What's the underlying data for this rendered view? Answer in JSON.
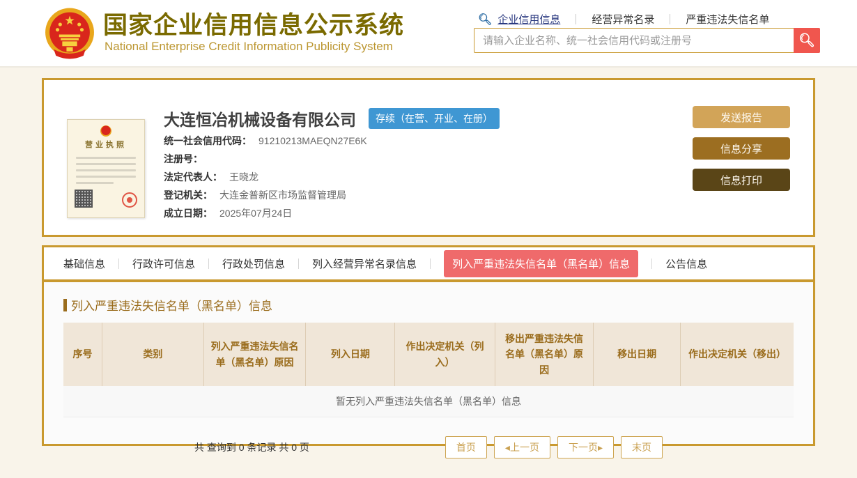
{
  "header": {
    "title": "国家企业信用信息公示系统",
    "subtitle": "National Enterprise Credit Information Publicity System",
    "search_icon": "search-icon",
    "nav": [
      {
        "label": "企业信用信息"
      },
      {
        "label": "经营异常名录"
      },
      {
        "label": "严重违法失信名单"
      }
    ],
    "search": {
      "placeholder": "请输入企业名称、统一社会信用代码或注册号",
      "value": "",
      "button_icon": "search-icon"
    }
  },
  "company": {
    "name": "大连恒冶机械设备有限公司",
    "status_badge": "存续（在营、开业、在册）",
    "license_title": "营业执照",
    "fields": [
      {
        "label": "统一社会信用代码：",
        "value": "91210213MAEQN27E6K"
      },
      {
        "label": "注册号：",
        "value": ""
      },
      {
        "label": "法定代表人：",
        "value": "王晓龙"
      },
      {
        "label": "登记机关：",
        "value": "大连金普新区市场监督管理局"
      },
      {
        "label": "成立日期：",
        "value": "2025年07月24日"
      }
    ],
    "actions": [
      {
        "label": "发送报告",
        "color": "#d2a458"
      },
      {
        "label": "信息分享",
        "color": "#9c6e21"
      },
      {
        "label": "信息打印",
        "color": "#5a4517"
      }
    ]
  },
  "tabs": [
    {
      "label": "基础信息",
      "active": false
    },
    {
      "label": "行政许可信息",
      "active": false
    },
    {
      "label": "行政处罚信息",
      "active": false
    },
    {
      "label": "列入经营异常名录信息",
      "active": false
    },
    {
      "label": "列入严重违法失信名单（黑名单）信息",
      "active": true
    },
    {
      "label": "公告信息",
      "active": false
    }
  ],
  "section": {
    "title": "列入严重违法失信名单（黑名单）信息"
  },
  "table": {
    "headers": [
      "序号",
      "类别",
      "列入严重违法失信名单（黑名单）原因",
      "列入日期",
      "作出决定机关（列入）",
      "移出严重违法失信名单（黑名单）原因",
      "移出日期",
      "作出决定机关（移出）"
    ],
    "empty_text": "暂无列入严重违法失信名单（黑名单）信息",
    "rows": []
  },
  "pagination": {
    "summary": "共 查询到 0 条记录 共 0 页",
    "buttons": [
      {
        "label": "首页"
      },
      {
        "label": "◂上一页"
      },
      {
        "label": "下一页▸"
      },
      {
        "label": "末页"
      }
    ]
  },
  "colors": {
    "gold_border": "#c9992f",
    "active_tab_red": "#ef6a6b",
    "search_button_red": "#f0564e",
    "status_badge_blue": "#3f97d3",
    "table_header_brown": "#9a6c1c",
    "page_background": "#f9f4ea"
  }
}
